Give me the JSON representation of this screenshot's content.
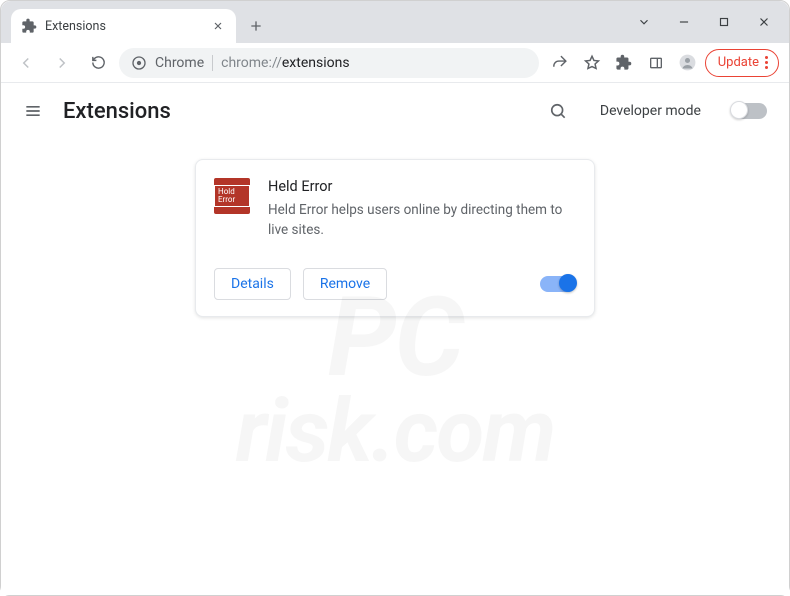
{
  "window": {
    "tab_title": "Extensions",
    "dropdown_glyph": "⌄"
  },
  "toolbar": {
    "chip_label": "Chrome",
    "url_prefix": "chrome://",
    "url_path": "extensions",
    "update_label": "Update"
  },
  "page": {
    "title": "Extensions",
    "developer_mode_label": "Developer mode"
  },
  "extension": {
    "logo_text": "Hold\nError",
    "name": "Held Error",
    "description": "Held Error helps users online by directing them to live sites.",
    "details_label": "Details",
    "remove_label": "Remove"
  },
  "watermark": {
    "line1": "PC",
    "line2": "risk.com"
  }
}
